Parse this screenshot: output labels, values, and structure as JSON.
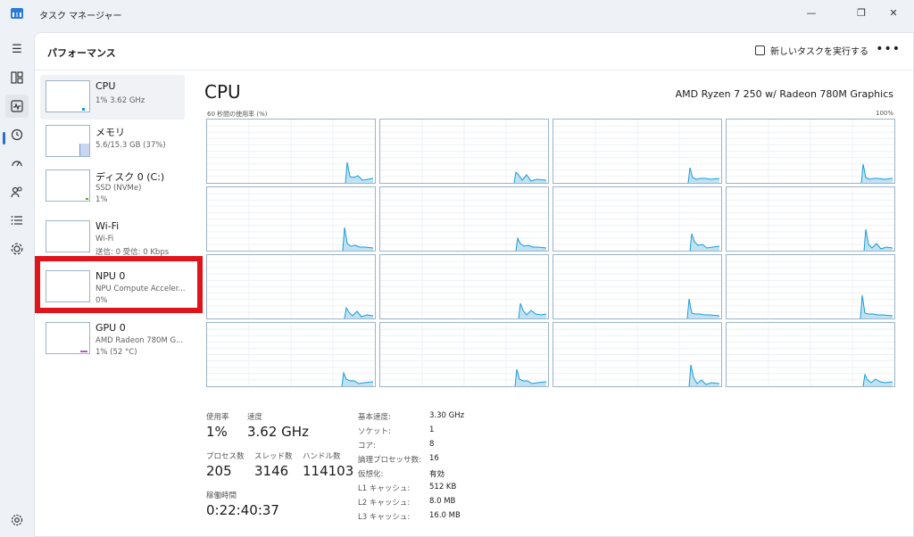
{
  "window": {
    "title": "タスク マネージャー",
    "controls": [
      "—",
      "❐",
      "✕"
    ]
  },
  "rail": {
    "icons": [
      "menu-icon",
      "processes-icon",
      "performance-icon",
      "history-icon",
      "startup-icon",
      "users-icon",
      "details-icon",
      "services-icon",
      "settings-icon"
    ]
  },
  "header": {
    "title": "パフォーマンス",
    "new_task_label": "新しいタスクを実行する",
    "more_label": "•••"
  },
  "devices": [
    {
      "name": "CPU",
      "sub1": "1%  3.62 GHz",
      "sub2": ""
    },
    {
      "name": "メモリ",
      "sub1": "5.6/15.3 GB (37%)",
      "sub2": ""
    },
    {
      "name": "ディスク 0 (C:)",
      "sub1": "SSD (NVMe)",
      "sub2": "1%"
    },
    {
      "name": "Wi-Fi",
      "sub1": "Wi-Fi",
      "sub2": "送信: 0  受信: 0 Kbps"
    },
    {
      "name": "NPU 0",
      "sub1": "NPU Compute Acceler...",
      "sub2": "0%"
    },
    {
      "name": "GPU 0",
      "sub1": "AMD Radeon 780M G...",
      "sub2": "1% (52 °C)"
    }
  ],
  "main": {
    "title": "CPU",
    "model": "AMD Ryzen 7 250 w/ Radeon 780M Graphics",
    "axis_left": "60 秒間の使用率 (%)",
    "axis_right": "100%"
  },
  "stats": {
    "usage_label": "使用率",
    "usage_value": "1%",
    "speed_label": "速度",
    "speed_value": "3.62 GHz",
    "processes_label": "プロセス数",
    "processes_value": "205",
    "threads_label": "スレッド数",
    "threads_value": "3146",
    "handles_label": "ハンドル数",
    "handles_value": "114103",
    "uptime_label": "稼働時間",
    "uptime_value": "0:22:40:37"
  },
  "info": [
    {
      "label": "基本速度:",
      "value": "3.30 GHz"
    },
    {
      "label": "ソケット:",
      "value": "1"
    },
    {
      "label": "コア:",
      "value": "8"
    },
    {
      "label": "論理プロセッサ数:",
      "value": "16"
    },
    {
      "label": "仮想化:",
      "value": "有効"
    },
    {
      "label": "L1 キャッシュ:",
      "value": "512 KB"
    },
    {
      "label": "L2 キャッシュ:",
      "value": "8.0 MB"
    },
    {
      "label": "L3 キャッシュ:",
      "value": "16.0 MB"
    }
  ],
  "colors": {
    "accent": "#2a6fc9",
    "cpu_line": "#1a9bd6",
    "cpu_fill": "#bfe3f3",
    "highlight": "#e0141b",
    "memory_fill": "#c8d6f0"
  }
}
